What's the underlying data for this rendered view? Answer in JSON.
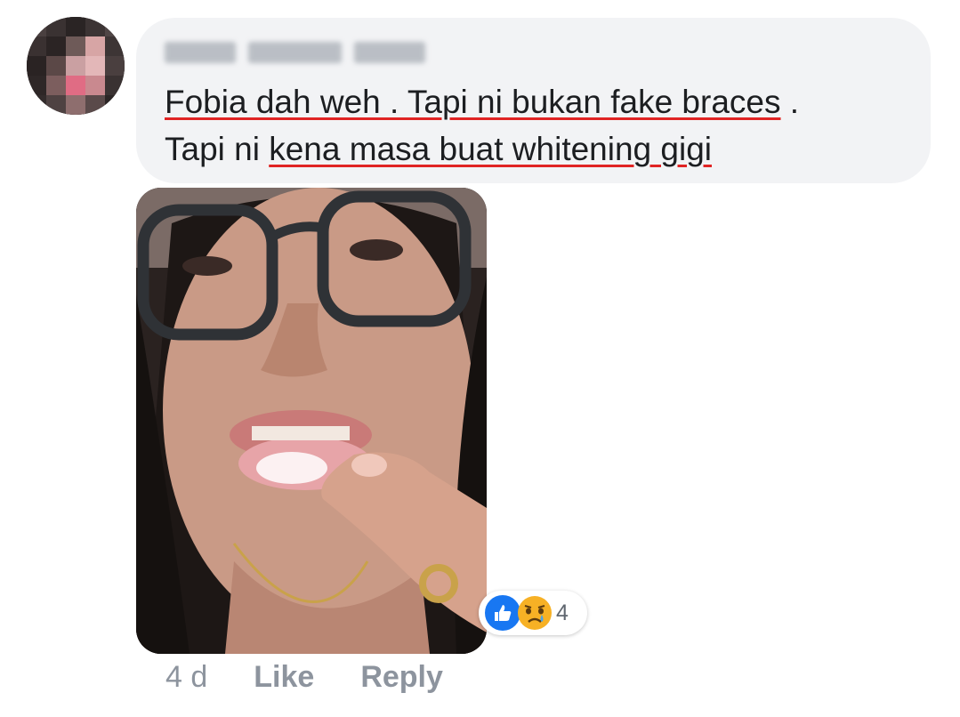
{
  "comment": {
    "author_name": "Mind Suhana Azmi",
    "text_line1_a": "Fobia dah weh . Tapi ni bukan fake braces",
    "text_line1_b": " .",
    "text_line2_a": "Tapi ni ",
    "text_line2_b": "kena masa buat whitening gigi"
  },
  "reactions": {
    "count": "4",
    "icons": [
      "like-icon",
      "sad-icon"
    ],
    "like_color": "#1877f2",
    "sad_color": "#f7b125"
  },
  "footer": {
    "time": "4 d",
    "like_label": "Like",
    "reply_label": "Reply"
  }
}
